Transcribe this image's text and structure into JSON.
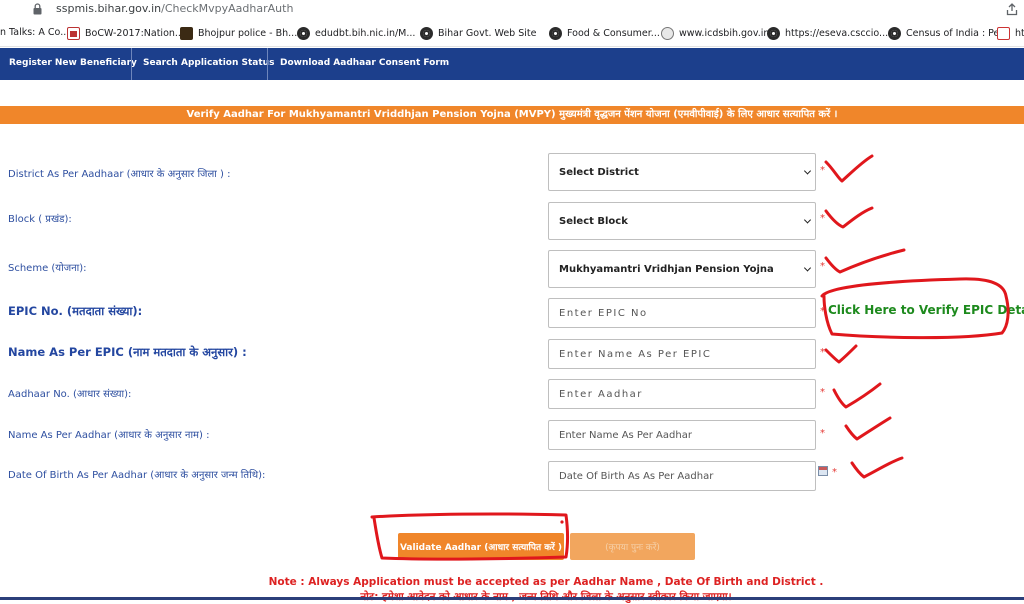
{
  "browser": {
    "url_host": "sspmis.bihar.gov.in",
    "url_path": "/CheckMvpyAadharAuth",
    "bookmarks": [
      {
        "label": "n Talks: A Co...",
        "icon": "bookmark-favicon"
      },
      {
        "label": "BoCW-2017:Nation...",
        "icon": "bocw-favicon"
      },
      {
        "label": "Bhojpur police - Bh...",
        "icon": "police-favicon"
      },
      {
        "label": "edudbt.bih.nic.in/M...",
        "icon": "globe-icon"
      },
      {
        "label": "Bihar Govt. Web Site",
        "icon": "globe-icon"
      },
      {
        "label": "Food & Consumer...",
        "icon": "globe-icon"
      },
      {
        "label": "www.icdsbih.gov.in",
        "icon": "icds-favicon"
      },
      {
        "label": "https://eseva.csccio...",
        "icon": "globe-icon"
      },
      {
        "label": "Census of India : Pe...",
        "icon": "globe-icon"
      },
      {
        "label": "ht",
        "icon": "nsdl-favicon"
      }
    ]
  },
  "nav": {
    "items": [
      "Register New Beneficiary",
      "Search Application Status",
      "Download Aadhaar Consent Form"
    ]
  },
  "banner": {
    "title": "Verify Aadhar For Mukhyamantri Vriddhjan Pension Yojna (MVPY)  मुख्यमंत्री वृद्धजन पेंशन योजना (एमवीपीवाई) के लिए आधार सत्यापित करें ।"
  },
  "form": {
    "district": {
      "label": "District As Per Aadhaar (आधार के अनुसार जिला ) :",
      "value": "Select District"
    },
    "block": {
      "label": "Block ( प्रखंड):",
      "value": "Select Block"
    },
    "scheme": {
      "label": "Scheme (योजना):",
      "value": "Mukhyamantri Vridhjan Pension Yojna"
    },
    "epic": {
      "label": "EPIC No. (मतदाता संख्या):",
      "placeholder": "Enter EPIC No",
      "link": "Click Here to Verify EPIC Details"
    },
    "name_epic": {
      "label": "Name As Per EPIC (नाम मतदाता के अनुसार) :",
      "placeholder": "Enter Name As Per EPIC"
    },
    "aadhaar": {
      "label": "Aadhaar No. (आधार संख्या):",
      "placeholder": "Enter Aadhar"
    },
    "name_aadhar": {
      "label": "Name As Per Aadhar (आधार के अनुसार नाम) :",
      "placeholder": "Enter Name As Per Aadhar"
    },
    "dob": {
      "label": "Date Of Birth As Per Aadhar (आधार के अनुसार जन्म तिथि):",
      "placeholder": "Date Of Birth As As Per Aadhar"
    },
    "required_mark": "*"
  },
  "buttons": {
    "validate": "Validate Aadhar (आधार सत्यापित करें )",
    "second": "(कृपया पुनः करें)"
  },
  "note": {
    "line1": "Note : Always Application must be accepted as per Aadhar Name , Date Of Birth and District .",
    "line2": "नोट: हमेशा आवेदन को आधार के नाम , जन्म तिथि और जिला के अनुसार स्वीकार किया जाएगा।"
  },
  "colors": {
    "nav": "#1c3f8c",
    "banner": "#f0862a",
    "label": "#2e4fa0",
    "link_green": "#1d8a1d",
    "note_red": "#dd2222",
    "annotation_red": "#e0171c"
  }
}
